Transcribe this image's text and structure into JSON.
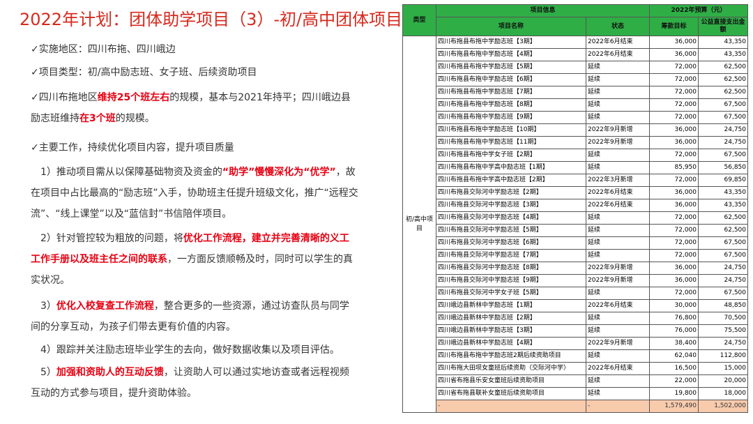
{
  "title": "2022年计划：团体助学项目（3）-初/高中团体项目",
  "left": {
    "p1": "✓实施地区：四川布拖、四川峨边",
    "p2": "✓项目类型：初/高中励志班、女子班、后续资助项目",
    "p3a": "✓四川布拖地区",
    "p3b": "维持25个班左右",
    "p3c": "的规模，基本与2021年持平；四川峨边县励志班维持",
    "p3d": "在3个班",
    "p3e": "的规模。",
    "p4": "✓主要工作，持续优化项目内容，提升项目质量",
    "p5a": "1）推动项目需从以保障基础物资及资金的",
    "p5b": "“助学”慢慢深化为“优学”",
    "p5c": "，故在项目中占比最高的“励志班”入手，协助班主任提升班级文化，推广“远程交流”、“线上课堂”以及“蓝信封”书信陪伴项目。",
    "p6a": "2）针对管控较为粗放的问题，将",
    "p6b": "优化工作流程，建立并完善清晰的义工工作手册以及班主任之间的联系",
    "p6c": "，一方面反馈顺畅及时，同时可以学生的真实状况。",
    "p7a": "3）",
    "p7b": "优化入校复查工作流程",
    "p7c": "，整合更多的一些资源，通过访查队员与同学间的分享互动，为孩子们带去更有价值的内容。",
    "p8": "4）跟踪并关注励志班毕业学生的去向，做好数据收集以及项目评估。",
    "p9a": "5）",
    "p9b": "加强和资助人的互动反馈",
    "p9c": "，让资助人可以通过实地访查或者远程视频互动的方式参与项目，提升资助体验。"
  },
  "table": {
    "head": {
      "type": "类型",
      "project_info": "项目信息",
      "budget": "2022年预算（元）",
      "name": "项目名称",
      "status": "状态",
      "target": "筹款目标",
      "direct": "公益直接支出金额"
    },
    "type_label": "初/高中项目",
    "rows": [
      {
        "name": "四川布拖县布拖中学励志班【3期】",
        "status": "2022年6月结束",
        "target": "36,000",
        "direct": "43,350"
      },
      {
        "name": "四川布拖县布拖中学励志班【4期】",
        "status": "2022年6月结束",
        "target": "36,000",
        "direct": "43,350"
      },
      {
        "name": "四川布拖县布拖中学励志班【5期】",
        "status": "延续",
        "target": "72,000",
        "direct": "62,500"
      },
      {
        "name": "四川布拖县布拖中学励志班【6期】",
        "status": "延续",
        "target": "72,000",
        "direct": "62,500"
      },
      {
        "name": "四川布拖县布拖中学励志班【7期】",
        "status": "延续",
        "target": "72,000",
        "direct": "62,500"
      },
      {
        "name": "四川布拖县布拖中学励志班【8期】",
        "status": "延续",
        "target": "72,000",
        "direct": "67,500"
      },
      {
        "name": "四川布拖县布拖中学励志班【9期】",
        "status": "延续",
        "target": "72,000",
        "direct": "67,500"
      },
      {
        "name": "四川布拖县布拖中学励志班【10期】",
        "status": "2022年9月新增",
        "target": "36,000",
        "direct": "24,750"
      },
      {
        "name": "四川布拖县布拖中学励志班【11期】",
        "status": "2022年9月新增",
        "target": "36,000",
        "direct": "24,750"
      },
      {
        "name": "四川布拖县布拖中学女子班【2期】",
        "status": "延续",
        "target": "72,000",
        "direct": "67,500"
      },
      {
        "name": "四川布拖县布拖中学高中励志班【1期】",
        "status": "延续",
        "target": "85,950",
        "direct": "56,850"
      },
      {
        "name": "四川布拖县布拖中学高中励志班【2期】",
        "status": "2022年3月新增",
        "target": "72,000",
        "direct": "69,850"
      },
      {
        "name": "四川布拖县交际河中学励志班【2期】",
        "status": "2022年6月结束",
        "target": "36,000",
        "direct": "43,350"
      },
      {
        "name": "四川布拖县交际河中学励志班【3期】",
        "status": "2022年6月结束",
        "target": "36,000",
        "direct": "43,350"
      },
      {
        "name": "四川布拖县交际河中学励志班【4期】",
        "status": "延续",
        "target": "72,000",
        "direct": "62,500"
      },
      {
        "name": "四川布拖县交际河中学励志班【5期】",
        "status": "延续",
        "target": "72,000",
        "direct": "62,500"
      },
      {
        "name": "四川布拖县交际河中学励志班【6期】",
        "status": "延续",
        "target": "72,000",
        "direct": "67,500"
      },
      {
        "name": "四川布拖县交际河中学励志班【7期】",
        "status": "延续",
        "target": "72,000",
        "direct": "67,500"
      },
      {
        "name": "四川布拖县交际河中学励志班【8期】",
        "status": "2022年9月新增",
        "target": "36,000",
        "direct": "24,750"
      },
      {
        "name": "四川布拖县交际河中学励志班【9期】",
        "status": "2022年9月新增",
        "target": "36,000",
        "direct": "24,750"
      },
      {
        "name": "四川布拖县交际河中学女子班【5期】",
        "status": "延续",
        "target": "72,000",
        "direct": "67,500"
      },
      {
        "name": "四川峨边县新林中学励志班【1期】",
        "status": "2022年6月结束",
        "target": "30,000",
        "direct": "48,850"
      },
      {
        "name": "四川峨边县新林中学励志班【2期】",
        "status": "延续",
        "target": "76,800",
        "direct": "70,500"
      },
      {
        "name": "四川峨边县新林中学励志班【3期】",
        "status": "延续",
        "target": "76,000",
        "direct": "75,500"
      },
      {
        "name": "四川峨边县新林中学励志班【4期】",
        "status": "2022年9月新增",
        "target": "38,400",
        "direct": "24,750"
      },
      {
        "name": "四川布拖县布拖中学励志班2期后续资助项目",
        "status": "延续",
        "target": "62,040",
        "direct": "112,800"
      },
      {
        "name": "四川布拖大田坝女童班后续资助（交际河中学）",
        "status": "2022年6月结束",
        "target": "16,500",
        "direct": "15,000"
      },
      {
        "name": "四川省布拖县乐安女童班后续资助项目",
        "status": "延续",
        "target": "22,000",
        "direct": "20,000"
      },
      {
        "name": "四川省布拖县联补女童班后续资助项目",
        "status": "延续",
        "target": "19,800",
        "direct": "18,000"
      }
    ],
    "total": {
      "name": "-",
      "status": "-",
      "target": "1,579,490",
      "direct": "1,502,000"
    }
  }
}
